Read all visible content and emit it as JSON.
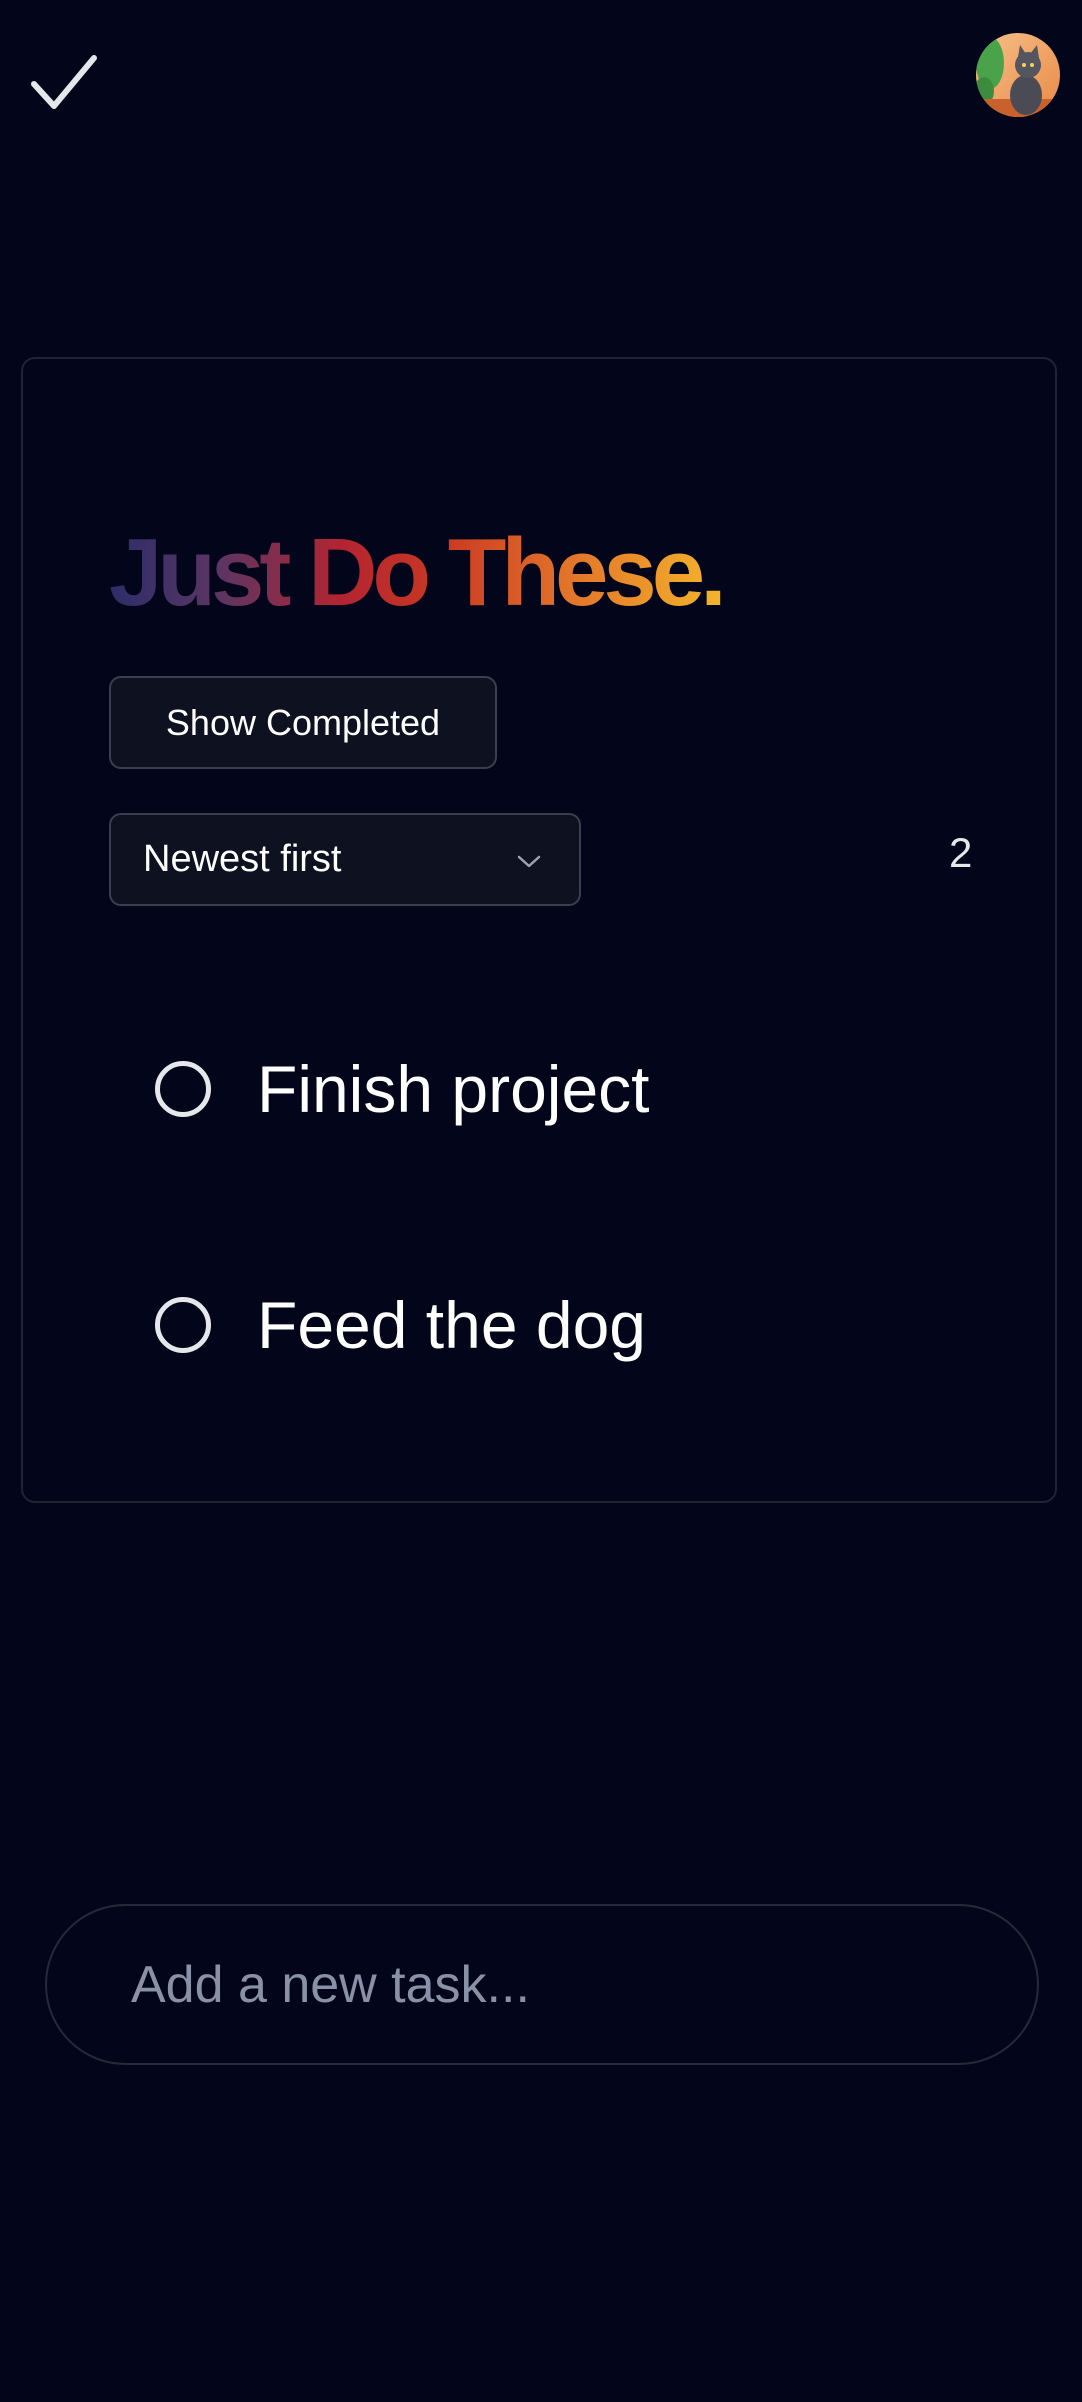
{
  "header": {
    "logo_icon": "checkmark-icon",
    "avatar": "cat-avatar"
  },
  "card": {
    "title": "Just Do These.",
    "show_completed_label": "Show Completed",
    "sort": {
      "selected": "Newest first",
      "icon": "chevron-down-icon"
    },
    "task_count": "2",
    "tasks": [
      {
        "label": "Finish project",
        "completed": false
      },
      {
        "label": "Feed the dog",
        "completed": false
      }
    ]
  },
  "composer": {
    "placeholder": "Add a new task..."
  },
  "colors": {
    "background": "#03061a",
    "title_gradient": [
      "#2b2e68",
      "#b42431",
      "#e3742a",
      "#f4b52a"
    ]
  }
}
